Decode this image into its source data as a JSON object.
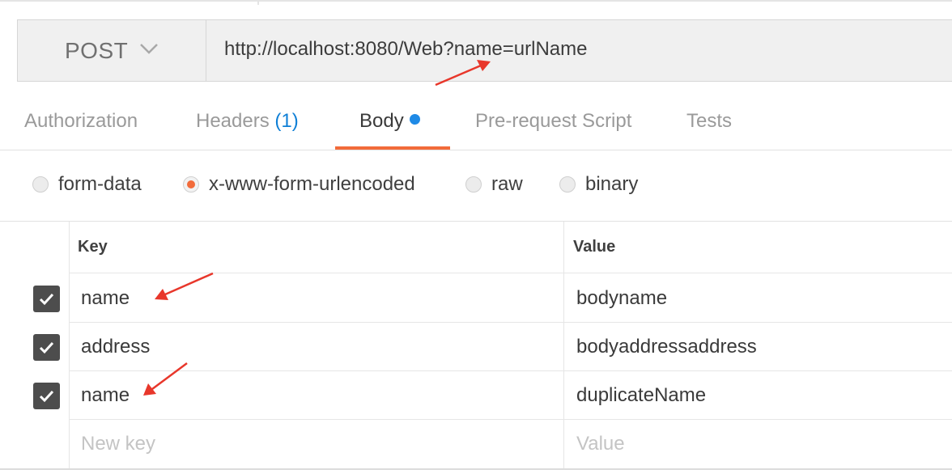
{
  "request": {
    "method": "POST",
    "url": "http://localhost:8080/Web?name=urlName"
  },
  "tabs": [
    {
      "label": "Authorization"
    },
    {
      "label": "Headers",
      "badge": "(1)"
    },
    {
      "label": "Body"
    },
    {
      "label": "Pre-request Script"
    },
    {
      "label": "Tests"
    }
  ],
  "active_tab": "Body",
  "body_types": [
    {
      "label": "form-data",
      "selected": false
    },
    {
      "label": "x-www-form-urlencoded",
      "selected": true
    },
    {
      "label": "raw",
      "selected": false
    },
    {
      "label": "binary",
      "selected": false
    }
  ],
  "table": {
    "headers": {
      "key": "Key",
      "value": "Value"
    },
    "rows": [
      {
        "checked": true,
        "key": "name",
        "value": "bodyname"
      },
      {
        "checked": true,
        "key": "address",
        "value": "bodyaddressaddress"
      },
      {
        "checked": true,
        "key": "name",
        "value": "duplicateName"
      }
    ],
    "new_row": {
      "key_placeholder": "New key",
      "value_placeholder": "Value"
    }
  },
  "colors": {
    "accent": "#f26b3a",
    "body_dot": "#1f8ae6",
    "annotation_arrow": "#e8372b"
  },
  "icons": [
    "chevron-down-icon",
    "checkmark-icon",
    "annotation-arrow"
  ]
}
